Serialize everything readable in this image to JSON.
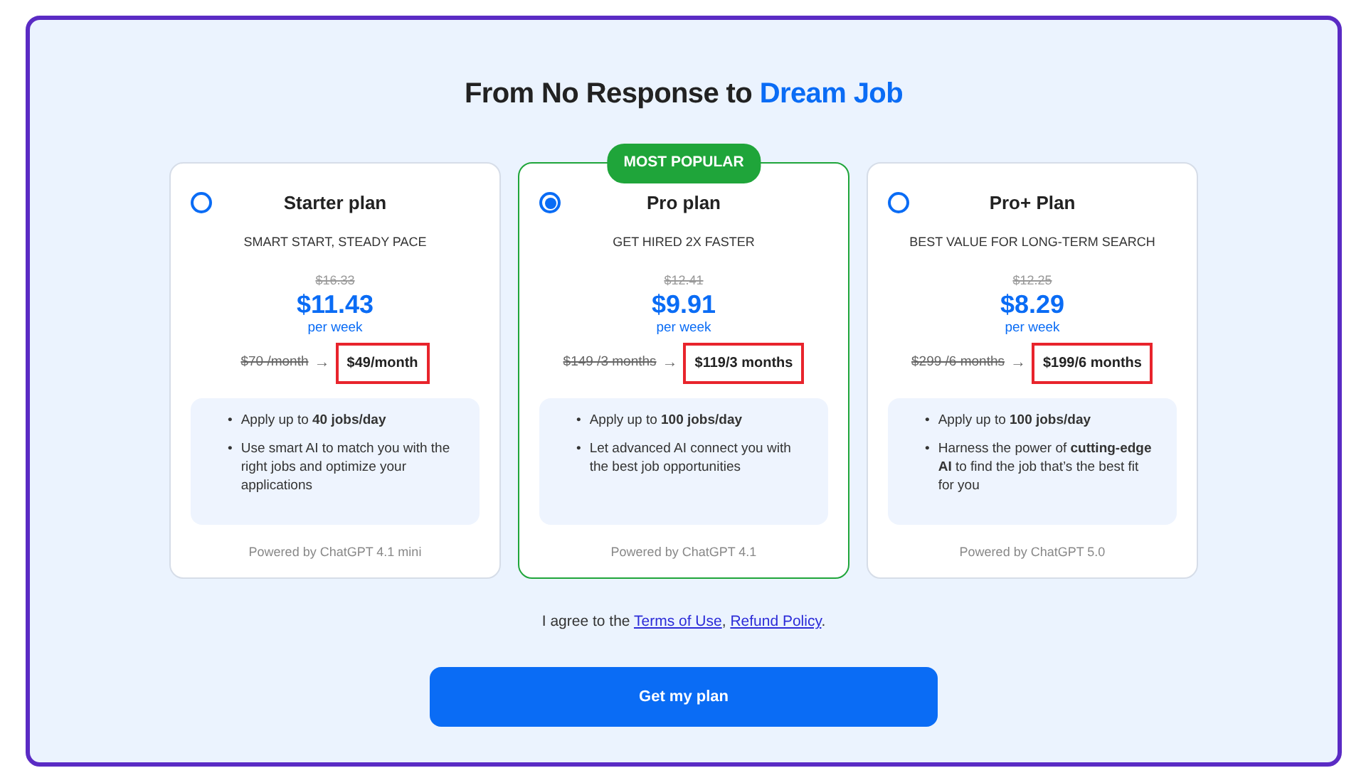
{
  "title": {
    "text": "From No Response to",
    "highlight": "Dream Job"
  },
  "plans": [
    {
      "name": "Starter plan",
      "selected": false,
      "tagline": "SMART START, STEADY PACE",
      "old_weekly": "$16.33",
      "weekly": "$11.43",
      "per": "per week",
      "old_total": "$70 /month",
      "arrow": "→",
      "total": "$49/month",
      "highlighted": true,
      "features": [
        {
          "bullet": "•",
          "text": "Apply up to **40 jobs/day**"
        },
        {
          "bullet": "•",
          "text": "Use smart AI to match you with the right jobs and optimize your applications"
        }
      ],
      "powered_by": "Powered by ChatGPT 4.1 mini"
    },
    {
      "name": "Pro plan",
      "selected": true,
      "badge": "MOST POPULAR",
      "tagline": "GET HIRED 2X FASTER",
      "old_weekly": "$12.41",
      "weekly": "$9.91",
      "per": "per week",
      "old_total": "$149 /3 months",
      "arrow": "→",
      "total": "$119/3 months",
      "highlighted": true,
      "features": [
        {
          "bullet": "•",
          "text": "Apply up to **100 jobs/day**"
        },
        {
          "bullet": "•",
          "text": "Let advanced AI connect you with the best job opportunities"
        }
      ],
      "powered_by": "Powered by ChatGPT 4.1"
    },
    {
      "name": "Pro+ Plan",
      "selected": false,
      "tagline": "BEST VALUE FOR LONG-TERM SEARCH",
      "old_weekly": "$12.25",
      "weekly": "$8.29",
      "per": "per week",
      "old_total": "$299 /6 months",
      "arrow": "→",
      "total": "$199/6 months",
      "highlighted": true,
      "features": [
        {
          "bullet": "•",
          "text": "Apply up to **100 jobs/day**"
        },
        {
          "bullet": "•",
          "text": "Harness the power of **cutting-edge AI** to find the job that’s the best fit for you"
        }
      ],
      "powered_by": "Powered by ChatGPT 5.0"
    }
  ],
  "agreement": {
    "text": "I agree to the",
    "links": [
      "Terms of Use",
      "Refund Policy"
    ],
    "separator": ",",
    "end": "."
  },
  "cta": "Get my plan"
}
